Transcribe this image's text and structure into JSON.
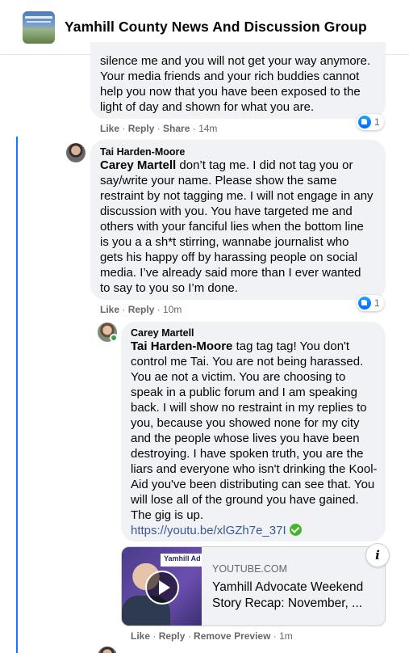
{
  "group": {
    "name": "Yamhill County News And Discussion Group"
  },
  "comments": [
    {
      "text": "silence me and you will not get your way anymore. Your media friends and your rich buddies cannot help you now that you have been exposed to the light of day and shown for what you are.",
      "actions": {
        "like": "Like",
        "reply": "Reply",
        "share": "Share",
        "time": "14m"
      },
      "reaction_count": "1"
    },
    {
      "author": "Tai Harden-Moore",
      "mention": "Carey Martell",
      "text": " don’t tag me. I did not tag you or say/write your name. Please show the same restraint by not tagging me. I will not engage in any discussion with you. You have targeted me and others with your fanciful lies when the bottom line is you a a sh*t stirring, wannabe journalist who gets his happy off by harassing people on social media. I’ve already said more than I ever wanted to say to you so I’m done.",
      "actions": {
        "like": "Like",
        "reply": "Reply",
        "time": "10m"
      },
      "reaction_count": "1"
    },
    {
      "author": "Carey Martell",
      "mention": "Tai Harden-Moore",
      "text": " tag tag tag! You don't control me Tai. You are not being harassed. You ae not a victim. You are choosing to speak in a public forum and I am speaking back. I will show no restraint in my replies to you, because you showed none for my city and the people whose lives you have been destroying. I have spoken truth, you are the liars and everyone who isn't drinking the Kool-Aid you've been distributing can see that. You will lose all of the ground you have gained. The gig is up.",
      "link": "https://youtu.be/xlGZh7e_37I",
      "preview": {
        "thumb_text": "Yamhill Ad",
        "domain": "YOUTUBE.COM",
        "title_line1": "Yamhill Advocate Weekend",
        "title_line2": "Story Recap: November, ..."
      },
      "actions": {
        "like": "Like",
        "reply": "Reply",
        "remove_preview": "Remove Preview",
        "time": "1m"
      }
    }
  ],
  "colors": {
    "link": "#385898",
    "thread_line": "#1877f2",
    "bubble": "#f0f2f5",
    "online": "#31a24c"
  },
  "icons": [
    "like-reaction-icon",
    "play-icon",
    "info-icon",
    "verified-check-icon"
  ]
}
